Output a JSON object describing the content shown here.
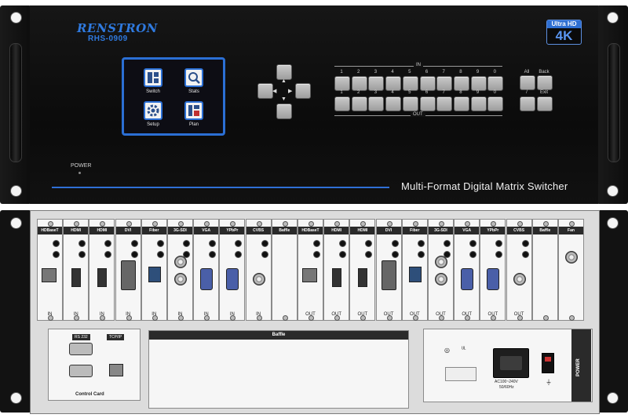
{
  "front_panel": {
    "brand": "RENSTRON",
    "model": "RHS-0909",
    "badge_top": "Ultra HD",
    "badge_main": "4K",
    "menu": [
      {
        "label": "Switch",
        "icon": "switch-icon"
      },
      {
        "label": "Stats",
        "icon": "search-icon"
      },
      {
        "label": "Setup",
        "icon": "gear-icon"
      },
      {
        "label": "Plan",
        "icon": "plan-icon"
      }
    ],
    "in_label": "IN",
    "out_label": "OUT",
    "in_keys": [
      "1",
      "2",
      "3",
      "4",
      "5",
      "6",
      "7",
      "8",
      "9",
      "0"
    ],
    "out_keys": [
      "1",
      "2",
      "3",
      "4",
      "5",
      "6",
      "7",
      "8",
      "9",
      "0"
    ],
    "func_keys": [
      "All",
      "Back",
      "/",
      "Exit"
    ],
    "power_label": "POWER",
    "title": "Multi-Format Digital Matrix Switcher"
  },
  "rear_panel": {
    "cards": [
      {
        "name": "HDBaseT",
        "dir": "IN"
      },
      {
        "name": "HDMI",
        "dir": "IN"
      },
      {
        "name": "HDMI",
        "dir": "IN"
      },
      {
        "name": "DVI",
        "dir": "IN"
      },
      {
        "name": "Fiber",
        "dir": "IN"
      },
      {
        "name": "3G-SDI",
        "dir": "IN"
      },
      {
        "name": "VGA",
        "dir": "IN"
      },
      {
        "name": "YPbPr",
        "dir": "IN"
      },
      {
        "name": "CVBS",
        "dir": "IN"
      },
      {
        "name": "Baffle",
        "dir": ""
      },
      {
        "name": "HDBaseT",
        "dir": "OUT"
      },
      {
        "name": "HDMI",
        "dir": "OUT"
      },
      {
        "name": "HDMI",
        "dir": "OUT"
      },
      {
        "name": "DVI",
        "dir": "OUT"
      },
      {
        "name": "Fiber",
        "dir": "OUT"
      },
      {
        "name": "3G-SDI",
        "dir": "OUT"
      },
      {
        "name": "VGA",
        "dir": "OUT"
      },
      {
        "name": "YPbPr",
        "dir": "OUT"
      },
      {
        "name": "CVBS",
        "dir": "OUT"
      },
      {
        "name": "Baffle",
        "dir": ""
      },
      {
        "name": "Fan",
        "dir": ""
      }
    ],
    "control_card": {
      "rs232": "RS 232",
      "tcpip": "TCP/IP",
      "label": "Control Card"
    },
    "baffle_label": "Baffle",
    "power_label": "POWER",
    "ac_rating": "AC100~240V",
    "ac_freq": "50/60Hz"
  }
}
